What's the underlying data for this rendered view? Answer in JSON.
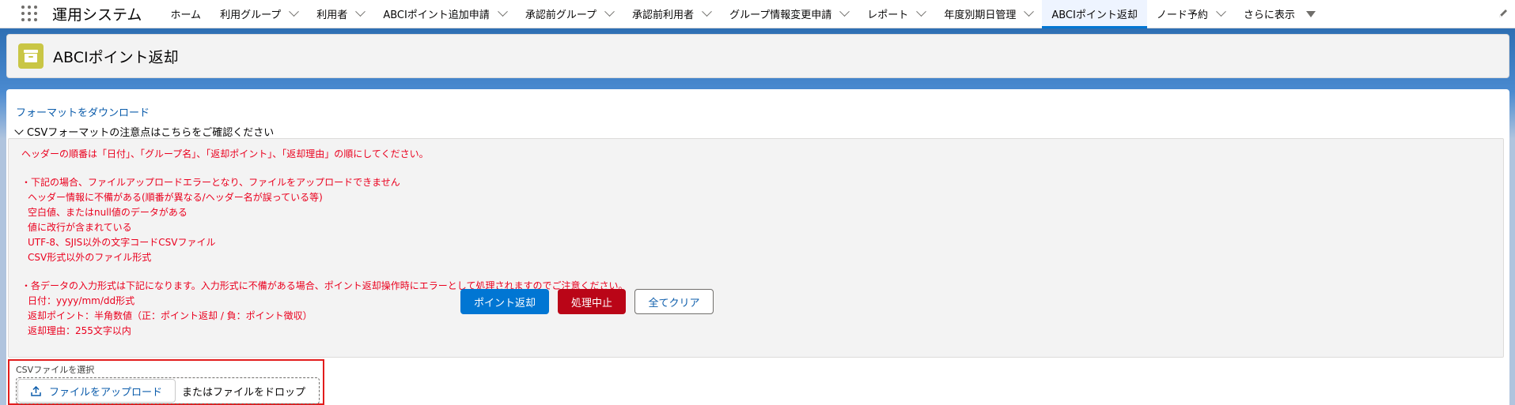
{
  "app": {
    "name": "運用システム"
  },
  "nav": {
    "items": [
      {
        "label": "ホーム",
        "has_menu": false
      },
      {
        "label": "利用グループ",
        "has_menu": true
      },
      {
        "label": "利用者",
        "has_menu": true
      },
      {
        "label": "ABCIポイント追加申請",
        "has_menu": true
      },
      {
        "label": "承認前グループ",
        "has_menu": true
      },
      {
        "label": "承認前利用者",
        "has_menu": true
      },
      {
        "label": "グループ情報変更申請",
        "has_menu": true
      },
      {
        "label": "レポート",
        "has_menu": true
      },
      {
        "label": "年度別期日管理",
        "has_menu": true
      },
      {
        "label": "ABCIポイント返却",
        "has_menu": false,
        "active": true
      },
      {
        "label": "ノード予約",
        "has_menu": true
      }
    ],
    "more_label": "さらに表示"
  },
  "header": {
    "title": "ABCIポイント返却",
    "icon": "archive-box-icon",
    "icon_color": "#c9c645"
  },
  "body": {
    "download_link": "フォーマットをダウンロード",
    "notice_toggle": "CSVフォーマットの注意点はこちらをご確認ください",
    "notice_lines": [
      {
        "text": "ヘッダーの順番は「日付」、「グループ名」、「返却ポイント」、「返却理由」の順にしてください。",
        "indent": false
      },
      {
        "text": "",
        "indent": false
      },
      {
        "text": "・下記の場合、ファイルアップロードエラーとなり、ファイルをアップロードできません",
        "indent": false
      },
      {
        "text": "ヘッダー情報に不備がある(順番が異なる/ヘッダー名が誤っている等)",
        "indent": true
      },
      {
        "text": "空白値、またはnull値のデータがある",
        "indent": true
      },
      {
        "text": "値に改行が含まれている",
        "indent": true
      },
      {
        "text": "UTF-8、SJIS以外の文字コードCSVファイル",
        "indent": true
      },
      {
        "text": "CSV形式以外のファイル形式",
        "indent": true
      },
      {
        "text": "",
        "indent": false
      },
      {
        "text": "・各データの入力形式は下記になります。入力形式に不備がある場合、ポイント返却操作時にエラーとして処理されますのでご注意ください。",
        "indent": false
      },
      {
        "text": "日付：yyyy/mm/dd形式",
        "indent": true
      },
      {
        "text": "返却ポイント：半角数値（正：ポイント返却 / 負：ポイント徴収）",
        "indent": true
      },
      {
        "text": "返却理由：255文字以内",
        "indent": true
      }
    ],
    "notice_color": "#ea001e"
  },
  "upload": {
    "label": "CSVファイルを選択",
    "button_label": "ファイルをアップロード",
    "drop_text": "またはファイルをドロップ"
  },
  "actions": {
    "return_label": "ポイント返却",
    "cancel_label": "処理中止",
    "clear_label": "全てクリア"
  }
}
